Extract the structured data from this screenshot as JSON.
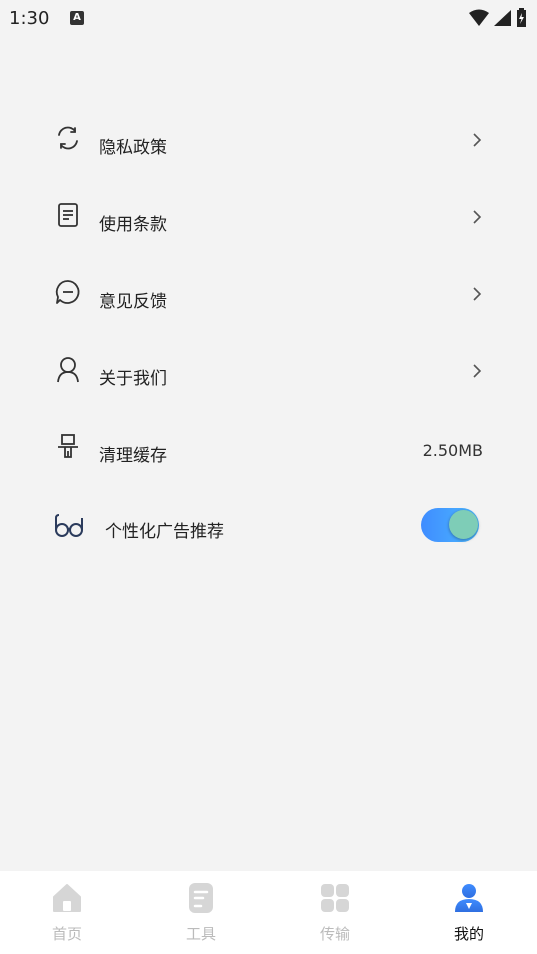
{
  "status_bar": {
    "time": "1:30",
    "badge": "A"
  },
  "menu": {
    "items": [
      {
        "label": "隐私政策",
        "icon": "refresh-icon"
      },
      {
        "label": "使用条款",
        "icon": "document-icon"
      },
      {
        "label": "意见反馈",
        "icon": "chat-bubble-icon"
      },
      {
        "label": "关于我们",
        "icon": "person-icon"
      },
      {
        "label": "清理缓存",
        "icon": "brush-icon",
        "value": "2.50MB"
      },
      {
        "label": "个性化广告推荐",
        "icon": "glasses-icon",
        "toggle_on": true
      }
    ]
  },
  "tabbar": {
    "tabs": [
      {
        "label": "首页",
        "icon": "home-icon"
      },
      {
        "label": "工具",
        "icon": "tools-icon"
      },
      {
        "label": "传输",
        "icon": "grid-icon"
      },
      {
        "label": "我的",
        "icon": "profile-icon",
        "active": true
      }
    ]
  },
  "colors": {
    "accent": "#3f8cff",
    "toggle_knob": "#7ecdb7",
    "inactive_tab": "#bbbbbb"
  }
}
